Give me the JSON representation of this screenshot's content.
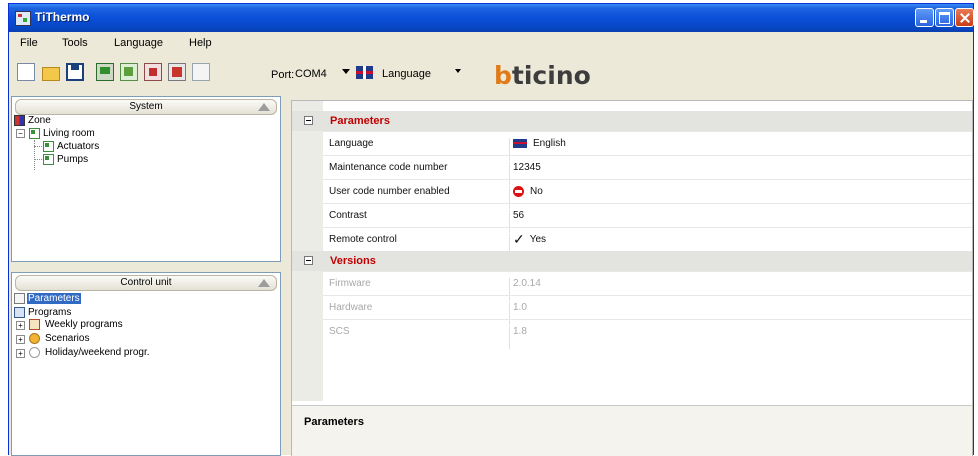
{
  "window": {
    "title": "TiThermo"
  },
  "menu": [
    "File",
    "Tools",
    "Language",
    "Help"
  ],
  "toolbar": {
    "port_label": "Port:",
    "port_value": "COM4",
    "language_label": "Language",
    "logo": "bticino"
  },
  "system_panel": {
    "header": "System",
    "tree": {
      "zone": "Zone",
      "room": "Living room",
      "actuators": "Actuators",
      "pumps": "Pumps"
    }
  },
  "control_panel": {
    "header": "Control unit",
    "tree": {
      "parameters": "Parameters",
      "programs": "Programs",
      "weekly": "Weekly programs",
      "scenarios": "Scenarios",
      "holiday": "Holiday/weekend progr."
    }
  },
  "properties": {
    "parameters_category": "Parameters",
    "language": {
      "name": "Language",
      "value": "English"
    },
    "maintenance": {
      "name": "Maintenance code number",
      "value": "12345"
    },
    "user_code": {
      "name": "User code number enabled",
      "value": "No"
    },
    "contrast": {
      "name": "Contrast",
      "value": "56"
    },
    "remote": {
      "name": "Remote control",
      "value": "Yes"
    },
    "versions_category": "Versions",
    "firmware": {
      "name": "Firmware",
      "value": "2.0.14"
    },
    "hardware": {
      "name": "Hardware",
      "value": "1.0"
    },
    "scs": {
      "name": "SCS",
      "value": "1.8"
    }
  },
  "help": {
    "title": "Parameters"
  },
  "colors": {
    "category": "#c00000",
    "selection": "#316ac5",
    "titlebar": "#0a4fd8",
    "logo_accent": "#e07b1a"
  }
}
